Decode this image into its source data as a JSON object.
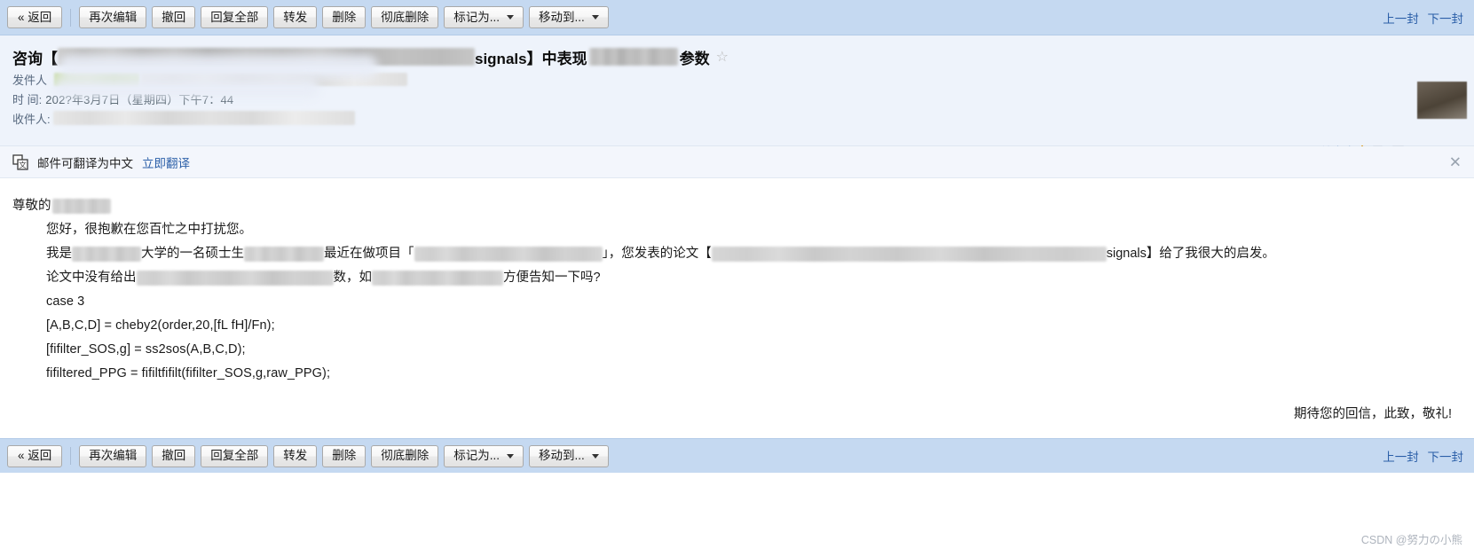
{
  "toolbar": {
    "buttons": [
      {
        "name": "back",
        "label": "« 返回",
        "dropdown": false
      },
      {
        "name": "edit-again",
        "label": "再次编辑",
        "dropdown": false
      },
      {
        "name": "recall",
        "label": "撤回",
        "dropdown": false
      },
      {
        "name": "reply-all",
        "label": "回复全部",
        "dropdown": false
      },
      {
        "name": "forward",
        "label": "转发",
        "dropdown": false
      },
      {
        "name": "delete",
        "label": "删除",
        "dropdown": false
      },
      {
        "name": "delete-permanently",
        "label": "彻底删除",
        "dropdown": false
      },
      {
        "name": "mark-as",
        "label": "标记为...",
        "dropdown": true
      },
      {
        "name": "move-to",
        "label": "移动到...",
        "dropdown": true
      }
    ],
    "prev_label": "上一封",
    "next_label": "下一封"
  },
  "header": {
    "subject_prefix": "咨询【",
    "subject_mid": "signals】中表现",
    "subject_suffix": "参数",
    "star_glyph": "☆",
    "sender_label": "发件人",
    "time_label": "时  间:",
    "time_value": "202?年3月7日（星期四）下午7：44",
    "recipient_label": "收件人:",
    "plain_text_label": "纯文本",
    "icons": [
      "new-window-icon",
      "document-icon",
      "save-icon",
      "print-icon",
      "chevron-double-down-icon"
    ]
  },
  "translate": {
    "text": "邮件可翻译为中文",
    "link": "立即翻译",
    "close_glyph": "✕",
    "icon_name": "translate-icon"
  },
  "body": {
    "salutation": "尊敬的",
    "line_greeting": "您好，很抱歉在您百忙之中打扰您。",
    "line3_a": "我是",
    "line3_b": "大学的一名硕士生",
    "line3_c": "最近在做项目「",
    "line3_d": "」，您发表的论文【",
    "line3_e": "signals】给了我很大的启发。",
    "line4_a": "论文中没有给出",
    "line4_b": "数，如",
    "line4_c": "方便告知一下吗?",
    "code": [
      "case 3",
      "[A,B,C,D] = cheby2(order,20,[fL fH]/Fn);",
      "[fifilter_SOS,g] = ss2sos(A,B,C,D);",
      "fifiltered_PPG = fifiltfifilt(fifilter_SOS,g,raw_PPG);"
    ],
    "closing": "期待您的回信，此致，敬礼!"
  },
  "watermark": "CSDN @努力の小熊",
  "colors": {
    "toolbar_bg": "#c5d9f1",
    "header_bg": "#eef3fb",
    "link": "#2b5fa8",
    "translate_bg": "#f3f6fc"
  }
}
